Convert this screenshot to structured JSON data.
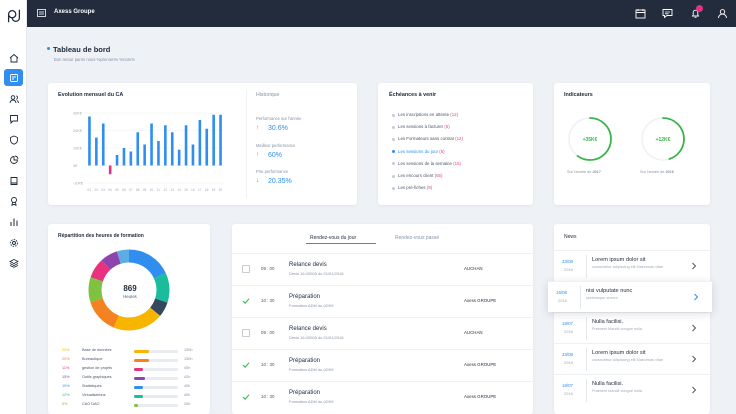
{
  "topbar": {
    "brand": "Axess Groupe"
  },
  "header": {
    "title": "Tableau de bord",
    "subtitle": "Bon retour parmi nous %prenom% %nom%"
  },
  "ca_card": {
    "title": "Evolution mensuel du CA",
    "history_title": "Historique",
    "stats": [
      {
        "label": "Performance sur l'année",
        "value": "30.6%",
        "arrow": "↑"
      },
      {
        "label": "Meilleur performance",
        "value": "60%",
        "arrow": "↑"
      },
      {
        "label": "Pire performance",
        "value": "20.35%",
        "arrow": "↓"
      }
    ]
  },
  "chart_data": {
    "type": "bar",
    "yticks": [
      "30K€",
      "20K€",
      "10K€",
      "0€",
      "-10K€"
    ],
    "ylim": [
      -10,
      30
    ],
    "xticks": [
      "01",
      "02",
      "03",
      "04",
      "05",
      "06",
      "07",
      "08",
      "09",
      "10",
      "11",
      "12",
      "13",
      "14",
      "15",
      "16",
      "17",
      "18",
      "19",
      "20"
    ],
    "values": [
      28,
      16,
      24,
      -5,
      6,
      10,
      8,
      19,
      12,
      24,
      14,
      23,
      19,
      9,
      23,
      12,
      26,
      21,
      29,
      29
    ],
    "colors": {
      "positive": "#2f8ef0",
      "negative": "#e8317f"
    }
  },
  "echeances": {
    "title": "Échéances à venir",
    "items": [
      {
        "label": "Les inscriptions en attente",
        "count": "(12)",
        "active": false
      },
      {
        "label": "Les sessions à facturer",
        "count": "(5)",
        "active": false
      },
      {
        "label": "Les Formateurs sans contrat",
        "count": "(12)",
        "active": false
      },
      {
        "label": "Les sessions du jour",
        "count": "(5)",
        "active": true
      },
      {
        "label": "Les sessions de la semaine",
        "count": "(15)",
        "active": false
      },
      {
        "label": "Les encours client",
        "count": "(65)",
        "active": false
      },
      {
        "label": "Les pré-fiches",
        "count": "(9)",
        "active": false
      }
    ]
  },
  "indicateurs": {
    "title": "Indicateurs",
    "items": [
      {
        "value": "+35K€",
        "caption_prefix": "Sur l'année de",
        "year": "2017",
        "progress": 0.6
      },
      {
        "value": "+12K€",
        "caption_prefix": "Sur l'année de",
        "year": "2016",
        "progress": 0.45
      }
    ]
  },
  "formation": {
    "title": "Répartition des heures de formation",
    "total": "869",
    "unit": "Heures",
    "rows": [
      {
        "pct": "20%",
        "label": "Base de données",
        "hours": "150h",
        "color": "#f7b500",
        "fill": 0.35
      },
      {
        "pct": "20%",
        "label": "Bureautique",
        "hours": "150h",
        "color": "#f58220",
        "fill": 0.35
      },
      {
        "pct": "11%",
        "label": "gestion de projets",
        "hours": "40h",
        "color": "#e8317f",
        "fill": 0.2
      },
      {
        "pct": "15%",
        "label": "Outils graphiques",
        "hours": "42h",
        "color": "#8e44ad",
        "fill": 0.25
      },
      {
        "pct": "10%",
        "label": "Statistiques",
        "hours": "40h",
        "color": "#2f8ef0",
        "fill": 0.2
      },
      {
        "pct": "12%",
        "label": "Virtualisations",
        "hours": "40h",
        "color": "#1abc9c",
        "fill": 0.2
      },
      {
        "pct": "5%",
        "label": "CAO DAO",
        "hours": "20h",
        "color": "#7fc241",
        "fill": 0.1
      }
    ],
    "donut": [
      {
        "color": "#2f8ef0",
        "share": 0.18
      },
      {
        "color": "#1abc9c",
        "share": 0.12
      },
      {
        "color": "#34495e",
        "share": 0.06
      },
      {
        "color": "#f7b500",
        "share": 0.2
      },
      {
        "color": "#f58220",
        "share": 0.14
      },
      {
        "color": "#7fc241",
        "share": 0.1
      },
      {
        "color": "#e8317f",
        "share": 0.08
      },
      {
        "color": "#8e44ad",
        "share": 0.07
      },
      {
        "color": "#5dade2",
        "share": 0.05
      }
    ]
  },
  "rdv": {
    "tabs": [
      {
        "label": "Rendez-vous du jour",
        "active": true
      },
      {
        "label": "Rendez-vous passé",
        "active": false
      }
    ],
    "rows": [
      {
        "done": false,
        "time": "09 : 00",
        "title": "Relance devis",
        "sub": "Devis 16.00005 du 01/01/2018",
        "client": "AUCHAN"
      },
      {
        "done": true,
        "time": "10 : 30",
        "title": "Préparation",
        "sub": "Formation ADM du 02/09",
        "client": "Axess GROUPE"
      },
      {
        "done": false,
        "time": "09 : 00",
        "title": "Relance devis",
        "sub": "Devis 16.00005 du 01/01/2018",
        "client": "AUCHAN"
      },
      {
        "done": true,
        "time": "10 : 30",
        "title": "Préparation",
        "sub": "Formation ADM du 02/09",
        "client": "Axess GROUPE"
      },
      {
        "done": true,
        "time": "10 : 30",
        "title": "Préparation",
        "sub": "Formation ADM du 02/09",
        "client": "Axess GROUPE"
      }
    ]
  },
  "news": {
    "title": "News",
    "items": [
      {
        "date": "23/08",
        "year": "2016",
        "title": "Lorem ipsum dolor sit",
        "sub": "consectetur adipiscing elit Maecenas vitae",
        "highlight": false
      },
      {
        "date": "16/08",
        "year": "2016",
        "title": "nisi vulputate nunc",
        "sub": "scelerisque viverra",
        "highlight": true
      },
      {
        "date": "19/07",
        "year": "2016",
        "title": "Nulla facilisi.",
        "sub": "Praesent blandit congue nulla",
        "highlight": false
      },
      {
        "date": "23/08",
        "year": "2016",
        "title": "Lorem ipsum dolor sit",
        "sub": "consectetur adipiscing elit Maecenas vitae",
        "highlight": false
      },
      {
        "date": "19/07",
        "year": "2016",
        "title": "Nulla facilisi.",
        "sub": "Praesent blandit congue nulla",
        "highlight": false
      }
    ]
  }
}
